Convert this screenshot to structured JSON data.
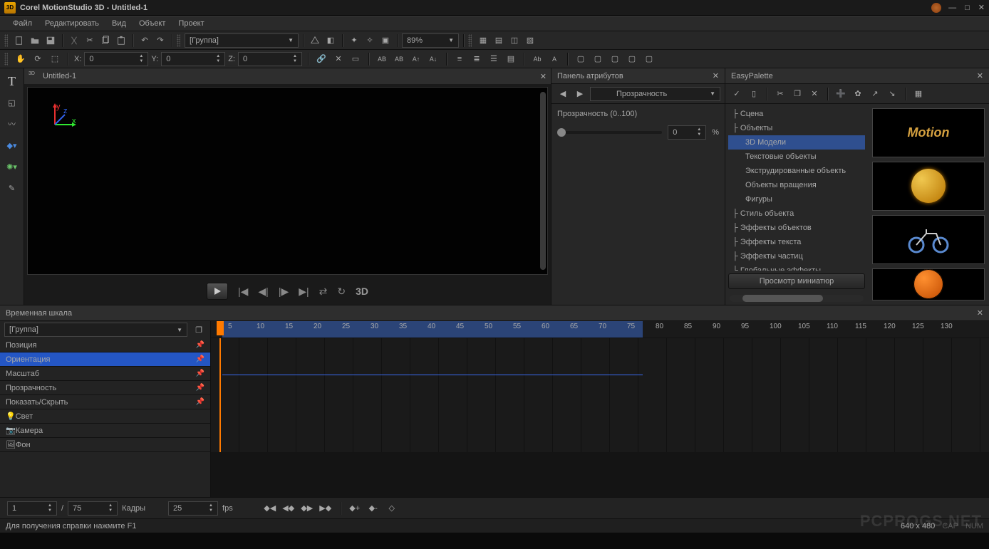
{
  "title": "Corel MotionStudio 3D - Untitled-1",
  "menu": {
    "file": "Файл",
    "edit": "Редактировать",
    "view": "Вид",
    "object": "Объект",
    "project": "Проект"
  },
  "toolbar": {
    "group_combo": "[Группа]",
    "zoom": "89%"
  },
  "coords": {
    "x_label": "X:",
    "x": "0",
    "y_label": "Y:",
    "y": "0",
    "z_label": "Z:",
    "z": "0"
  },
  "viewport": {
    "tab_title": "Untitled-1",
    "three_d": "3D"
  },
  "attr_panel": {
    "title": "Панель атрибутов",
    "mode": "Прозрачность",
    "opacity_label": "Прозрачность (0..100)",
    "opacity_value": "0",
    "percent": "%"
  },
  "easy_palette": {
    "title": "EasyPalette",
    "preview_btn": "Просмотр миниатюр",
    "tree": {
      "scene": "Сцена",
      "objects": "Объекты",
      "models_3d": "3D Модели",
      "text_objects": "Текстовые объекты",
      "extruded": "Экструдированные объекть",
      "revolve": "Объекты вращения",
      "shapes": "Фигуры",
      "obj_style": "Стиль объекта",
      "obj_fx": "Эффекты объектов",
      "text_fx": "Эффекты текста",
      "particle_fx": "Эффекты частиц",
      "global_fx": "Глобальные эффекты"
    }
  },
  "timeline": {
    "title": "Временная шкала",
    "group_combo": "[Группа]",
    "tracks": {
      "position": "Позиция",
      "orientation": "Ориентация",
      "scale": "Масштаб",
      "opacity": "Прозрачность",
      "showhide": "Показать/Скрыть",
      "light": "Свет",
      "camera": "Камера",
      "background": "Фон"
    },
    "ruler_ticks": [
      "5",
      "10",
      "15",
      "20",
      "25",
      "30",
      "35",
      "40",
      "45",
      "50",
      "55",
      "60",
      "65",
      "70",
      "75",
      "80",
      "85",
      "90",
      "95",
      "100",
      "105",
      "110",
      "115",
      "120",
      "125",
      "130"
    ],
    "frame_current": "1",
    "frame_sep": "/",
    "frame_total": "75",
    "frames_label": "Кадры",
    "fps_value": "25",
    "fps_label": "fps"
  },
  "status": {
    "hint": "Для получения справки нажмите F1",
    "resolution": "640 x 480",
    "cap": "CAP",
    "num": "NUM"
  },
  "watermark": "PCPROGS.NET"
}
